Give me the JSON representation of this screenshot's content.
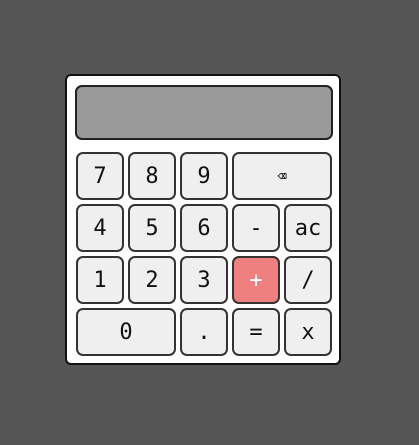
{
  "calculator": {
    "display": "",
    "keys": {
      "seven": "7",
      "eight": "8",
      "nine": "9",
      "backspace": "⌫",
      "four": "4",
      "five": "5",
      "six": "6",
      "minus": "-",
      "clear": "ac",
      "one": "1",
      "two": "2",
      "three": "3",
      "plus": "+",
      "divide": "/",
      "zero": "0",
      "decimal": ".",
      "equals": "=",
      "multiply": "x"
    }
  },
  "colors": {
    "background": "#555555",
    "panel": "#ffffff",
    "display": "#999999",
    "key": "#efefef",
    "accent_key": "#f08080"
  }
}
